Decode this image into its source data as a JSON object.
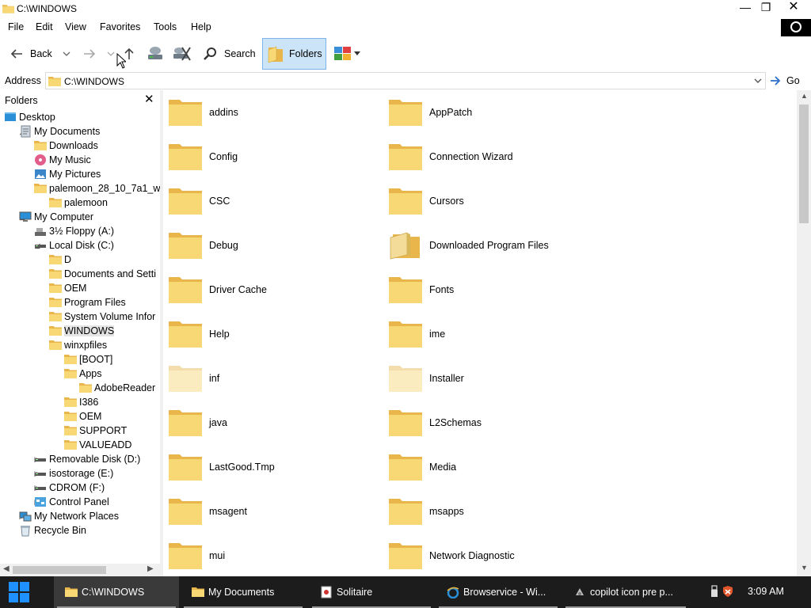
{
  "window": {
    "title": "C:\\WINDOWS",
    "controls": {
      "minimize": "—",
      "maximize": "❐",
      "close": "✕"
    }
  },
  "menu": [
    "File",
    "Edit",
    "View",
    "Favorites",
    "Tools",
    "Help"
  ],
  "toolbar": {
    "back_label": "Back",
    "search_label": "Search",
    "folders_label": "Folders"
  },
  "address": {
    "label": "Address",
    "value": "C:\\WINDOWS",
    "go_label": "Go"
  },
  "folders_pane": {
    "title": "Folders",
    "close": "✕",
    "tree": [
      {
        "label": "Desktop",
        "level": 0,
        "expander": "",
        "icon": "desktop-icon"
      },
      {
        "label": "My Documents",
        "level": 1,
        "expander": "open",
        "icon": "my-documents-icon"
      },
      {
        "label": "Downloads",
        "level": 2,
        "expander": "",
        "icon": "folder-icon"
      },
      {
        "label": "My Music",
        "level": 2,
        "expander": "",
        "icon": "music-icon"
      },
      {
        "label": "My Pictures",
        "level": 2,
        "expander": "",
        "icon": "pictures-icon"
      },
      {
        "label": "palemoon_28_10_7a1_w",
        "level": 2,
        "expander": "open",
        "icon": "folder-icon"
      },
      {
        "label": "palemoon",
        "level": 3,
        "expander": "closed",
        "icon": "folder-icon"
      },
      {
        "label": "My Computer",
        "level": 1,
        "expander": "open",
        "icon": "computer-icon"
      },
      {
        "label": "3½ Floppy (A:)",
        "level": 2,
        "expander": "",
        "icon": "floppy-icon"
      },
      {
        "label": "Local Disk (C:)",
        "level": 2,
        "expander": "open",
        "icon": "drive-icon"
      },
      {
        "label": "D",
        "level": 3,
        "expander": "closed",
        "icon": "folder-icon"
      },
      {
        "label": "Documents and Setti",
        "level": 3,
        "expander": "closed",
        "icon": "folder-icon"
      },
      {
        "label": "OEM",
        "level": 3,
        "expander": "closed",
        "icon": "folder-icon"
      },
      {
        "label": "Program Files",
        "level": 3,
        "expander": "closed",
        "icon": "folder-icon"
      },
      {
        "label": "System Volume Infor",
        "level": 3,
        "expander": "",
        "icon": "folder-icon"
      },
      {
        "label": "WINDOWS",
        "level": 3,
        "expander": "closed",
        "icon": "folder-icon",
        "selected": true
      },
      {
        "label": "winxpfiles",
        "level": 3,
        "expander": "open",
        "icon": "folder-icon"
      },
      {
        "label": "[BOOT]",
        "level": 4,
        "expander": "",
        "icon": "folder-icon"
      },
      {
        "label": "Apps",
        "level": 4,
        "expander": "open",
        "icon": "folder-icon"
      },
      {
        "label": "AdobeReader",
        "level": 5,
        "expander": "",
        "icon": "folder-icon"
      },
      {
        "label": "I386",
        "level": 4,
        "expander": "closed",
        "icon": "folder-icon"
      },
      {
        "label": "OEM",
        "level": 4,
        "expander": "closed",
        "icon": "folder-icon"
      },
      {
        "label": "SUPPORT",
        "level": 4,
        "expander": "closed",
        "icon": "folder-icon"
      },
      {
        "label": "VALUEADD",
        "level": 4,
        "expander": "closed",
        "icon": "folder-icon"
      },
      {
        "label": "Removable Disk (D:)",
        "level": 2,
        "expander": "closed",
        "icon": "drive-icon"
      },
      {
        "label": "isostorage (E:)",
        "level": 2,
        "expander": "closed",
        "icon": "drive-icon"
      },
      {
        "label": "CDROM (F:)",
        "level": 2,
        "expander": "closed",
        "icon": "drive-icon"
      },
      {
        "label": "Control Panel",
        "level": 2,
        "expander": "closed",
        "icon": "control-panel-icon"
      },
      {
        "label": "My Network Places",
        "level": 1,
        "expander": "closed",
        "icon": "network-icon"
      },
      {
        "label": "Recycle Bin",
        "level": 1,
        "expander": "",
        "icon": "recycle-bin-icon"
      }
    ]
  },
  "content": {
    "items": [
      {
        "name": "addins",
        "style": "normal"
      },
      {
        "name": "AppPatch",
        "style": "normal"
      },
      {
        "name": "Config",
        "style": "normal"
      },
      {
        "name": "Connection Wizard",
        "style": "normal"
      },
      {
        "name": "CSC",
        "style": "normal"
      },
      {
        "name": "Cursors",
        "style": "normal"
      },
      {
        "name": "Debug",
        "style": "normal"
      },
      {
        "name": "Downloaded Program Files",
        "style": "special"
      },
      {
        "name": "Driver Cache",
        "style": "normal"
      },
      {
        "name": "Fonts",
        "style": "normal"
      },
      {
        "name": "Help",
        "style": "normal"
      },
      {
        "name": "ime",
        "style": "normal"
      },
      {
        "name": "inf",
        "style": "hidden"
      },
      {
        "name": "Installer",
        "style": "hidden"
      },
      {
        "name": "java",
        "style": "normal"
      },
      {
        "name": "L2Schemas",
        "style": "normal"
      },
      {
        "name": "LastGood.Tmp",
        "style": "normal"
      },
      {
        "name": "Media",
        "style": "normal"
      },
      {
        "name": "msagent",
        "style": "normal"
      },
      {
        "name": "msapps",
        "style": "normal"
      },
      {
        "name": "mui",
        "style": "normal"
      },
      {
        "name": "Network Diagnostic",
        "style": "normal"
      }
    ]
  },
  "taskbar": {
    "tasks": [
      {
        "label": "C:\\WINDOWS",
        "icon": "folder-icon",
        "active": true
      },
      {
        "label": "My Documents",
        "icon": "folder-icon",
        "active": false
      },
      {
        "label": "Solitaire",
        "icon": "solitaire-icon",
        "active": false
      },
      {
        "label": "Browservice - Wi...",
        "icon": "ie-icon",
        "active": false
      },
      {
        "label": "copilot icon pre p...",
        "icon": "app-icon",
        "active": false
      }
    ],
    "clock": "3:09 AM"
  },
  "colors": {
    "folder": "#f8d775",
    "folder_dark": "#e8b64a",
    "selected_button": "#cce4f7",
    "taskbar": "#1c1c1c",
    "start": "#1e90ff"
  }
}
